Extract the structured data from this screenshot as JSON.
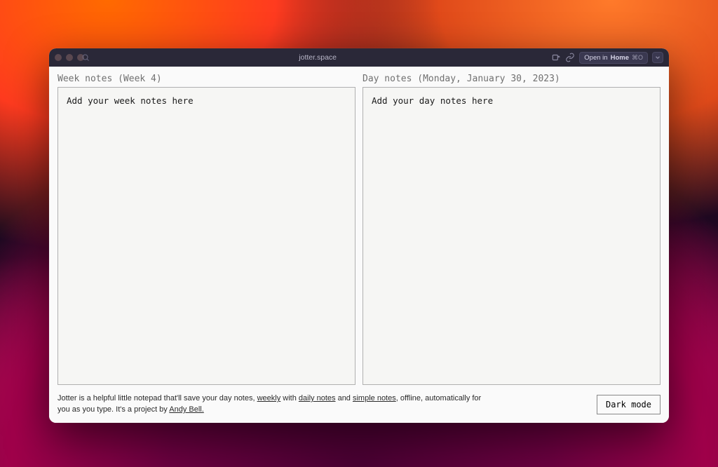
{
  "browser": {
    "url": "jotter.space",
    "open_in_label_prefix": "Open in ",
    "open_in_label_target": "Home",
    "open_in_shortcut": "⌘O"
  },
  "week_pane": {
    "heading": "Week notes (Week 4)",
    "placeholder": "Add your week notes here",
    "value": "Add your week notes here"
  },
  "day_pane": {
    "heading": "Day notes (Monday, January 30, 2023)",
    "placeholder": "Add your day notes here",
    "value": "Add your day notes here"
  },
  "footer": {
    "text_1": "Jotter is a helpful little notepad that'll save your day notes, ",
    "link_weekly": "weekly",
    "text_2": " with ",
    "link_daily": "daily notes",
    "text_3": " and ",
    "link_simple": "simple notes",
    "text_4": ", offline, automatically for you as you type. It's a project by ",
    "link_author": "Andy Bell.",
    "dark_mode_label": "Dark mode"
  }
}
